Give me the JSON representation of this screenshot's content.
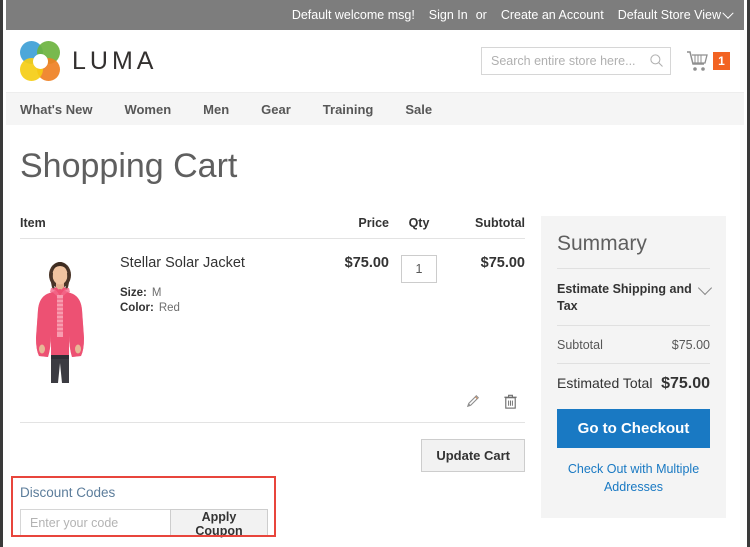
{
  "top_panel": {
    "welcome_msg": "Default welcome msg!",
    "sign_in": "Sign In",
    "or": "or",
    "create_account": "Create an Account",
    "store_view": "Default Store View"
  },
  "header": {
    "logo_text": "LUMA",
    "search_placeholder": "Search entire store here...",
    "cart_count": "1",
    "cart_badge_color": "#f26322"
  },
  "nav": {
    "items": [
      {
        "label": "What's New"
      },
      {
        "label": "Women"
      },
      {
        "label": "Men"
      },
      {
        "label": "Gear"
      },
      {
        "label": "Training"
      },
      {
        "label": "Sale"
      }
    ]
  },
  "main": {
    "page_title": "Shopping Cart",
    "table_headers": {
      "item": "Item",
      "price": "Price",
      "qty": "Qty",
      "subtotal": "Subtotal"
    },
    "rows": [
      {
        "name": "Stellar Solar Jacket",
        "price": "$75.00",
        "qty": "1",
        "subtotal": "$75.00",
        "options": [
          {
            "label": "Size:",
            "value": "M"
          },
          {
            "label": "Color:",
            "value": "Red"
          }
        ]
      }
    ],
    "update_cart_label": "Update Cart"
  },
  "summary": {
    "title": "Summary",
    "estimate_label": "Estimate Shipping and Tax",
    "subtotal_label": "Subtotal",
    "subtotal_value": "$75.00",
    "total_label": "Estimated Total",
    "total_value": "$75.00",
    "checkout_label": "Go to Checkout",
    "multi_address_label": "Check Out with Multiple Addresses",
    "checkout_color": "#1979c3"
  },
  "discount": {
    "title": "Discount Codes",
    "input_placeholder": "Enter your code",
    "apply_label": "Apply Coupon",
    "highlight_color": "#e8453c"
  }
}
